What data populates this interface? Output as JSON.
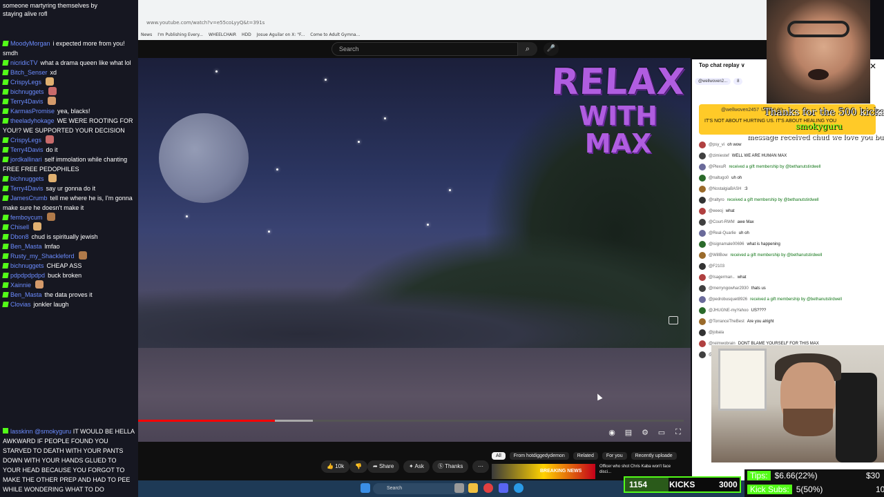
{
  "browser": {
    "url": "www.youtube.com/watch?v=e55coLyyQ&t=391s",
    "bookmarks": [
      "News",
      "I'm Publishing Every...",
      "WHEELCHAIR",
      "HDD",
      "Josue Aguilar on X: \"F...",
      "Come to Adult Gymna..."
    ]
  },
  "youtube": {
    "search_placeholder": "Search",
    "search_icon": "search-icon",
    "mic_icon": "mic-icon",
    "video_logo_line1": "RELAX",
    "video_logo_line2": "WITH MAX",
    "progress_fraction": 0.25,
    "buffer_fraction": 0.32,
    "actions": {
      "like_count": "10k",
      "share": "Share",
      "ask": "Ask",
      "thanks": "Thanks"
    },
    "chips": [
      "All",
      "From hotdiggedydemon",
      "Related",
      "For you",
      "Recently uploade"
    ],
    "rec": {
      "thumb_text": "BREAKING NEWS",
      "title": "Officer who shot Chris Kaba won't face disci..."
    },
    "taskbar_search": "Search"
  },
  "yt_chat": {
    "header": "Top chat replay",
    "pinned": [
      "@wellwoven2...",
      "8"
    ],
    "superchat": {
      "user": "@wellwoven2457",
      "amount": "US$10.00",
      "text": "IT'S NOT ABOUT HURTING US. IT'S ABOUT HEALING YOU"
    },
    "messages": [
      {
        "user": "@psy_vi",
        "text": "oh wow",
        "kind": "normal"
      },
      {
        "user": "@zimiestef",
        "text": "WELL WE ARE HUMAN MAX",
        "kind": "normal"
      },
      {
        "user": "@PlexuR",
        "text": "received a gift membership by @bethanutstirdwell",
        "kind": "member"
      },
      {
        "user": "@naltugo0",
        "text": "uh oh",
        "kind": "normal"
      },
      {
        "user": "@NostalgiaBASH",
        "text": ":3",
        "kind": "normal"
      },
      {
        "user": "@raltyro",
        "text": "received a gift membership by @bethanutstirdwell",
        "kind": "member"
      },
      {
        "user": "@eeeoj",
        "text": "what",
        "kind": "normal"
      },
      {
        "user": "@Court-RWM",
        "text": "awe Max",
        "kind": "normal"
      },
      {
        "user": "@Real-Quarlie",
        "text": "uh oh",
        "kind": "normal"
      },
      {
        "user": "@isignamale00696",
        "text": "what is happening",
        "kind": "normal"
      },
      {
        "user": "@WillBow",
        "text": "received a gift membership by @bethanutstirdwell",
        "kind": "member"
      },
      {
        "user": "@F2103",
        "text": "",
        "kind": "normal"
      },
      {
        "user": "@Isagerman..",
        "text": "what",
        "kind": "normal"
      },
      {
        "user": "@merryngowhar2930",
        "text": "thats us",
        "kind": "normal"
      },
      {
        "user": "@pedrobusquet8926",
        "text": "received a gift membership by @bethanutstirdwell",
        "kind": "member"
      },
      {
        "user": "@JHUGNE-myYahoo",
        "text": "US????",
        "kind": "normal"
      },
      {
        "user": "@TorranceTheBest",
        "text": "Are you alright",
        "kind": "normal"
      },
      {
        "user": "@jobala",
        "text": "",
        "kind": "normal"
      },
      {
        "user": "@reimwobrain",
        "text": "DONT BLAME YOURSELF FOR THIS MAX",
        "kind": "normal"
      },
      {
        "user": "@timhow12",
        "text": "received a gift membership by @bethanutstirdwell",
        "kind": "member"
      }
    ]
  },
  "kick_chat": {
    "top_lines": [
      "someone martyring themselves by",
      "staying alive rofl"
    ],
    "messages": [
      {
        "user": "MoodyMorgan",
        "text": "i expected more from you! smdh"
      },
      {
        "user": "nicridicTV",
        "text": "what a drama queen like what lol"
      },
      {
        "user": "Bitch_Senser",
        "text": "xd"
      },
      {
        "user": "CrispyLegs",
        "text": ""
      },
      {
        "user": "bichnuggets",
        "text": ""
      },
      {
        "user": "Terry4Davis",
        "text": ""
      },
      {
        "user": "KarmasPromise",
        "text": "yea, blacks!"
      },
      {
        "user": "theeladyhokage",
        "text": "WE WERE ROOTING FOR YOU!? WE SUPPORTED YOUR DECISION"
      },
      {
        "user": "CrispyLegs",
        "text": ""
      },
      {
        "user": "Terry4Davis",
        "text": "do it"
      },
      {
        "user": "jordkallinari",
        "text": "self immolation while chanting FREE FREE PEDOPHILES"
      },
      {
        "user": "bichnuggets",
        "text": ""
      },
      {
        "user": "Terry4Davis",
        "text": "say ur gonna do it"
      },
      {
        "user": "JamesCrumb",
        "text": "tell me where he is, I'm gonna make sure he doesn't make it"
      },
      {
        "user": "femboycum",
        "text": ""
      },
      {
        "user": "Chisell",
        "text": ""
      },
      {
        "user": "Dbon8",
        "text": "chud is spiritually jewish"
      },
      {
        "user": "Ben_Masta",
        "text": "lmfao"
      },
      {
        "user": "Rusty_my_Shackleford",
        "text": ""
      },
      {
        "user": "bichnuggets",
        "text": "CHEAP ASS"
      },
      {
        "user": "pdpdpdpdpd",
        "text": "buck broken"
      },
      {
        "user": "Xainnie",
        "text": ""
      },
      {
        "user": "Ben_Masta",
        "text": "the data proves it"
      },
      {
        "user": "Clovias",
        "text": "jonkler laugh"
      }
    ],
    "bottom": {
      "user": "lasskinn",
      "mention": "@smokyguru",
      "text": "IT WOULD BE HELLA AWKWARD IF PEOPLE FOUND YOU STARVED TO DEATH WITH YOUR PANTS DOWN WITH YOUR HANDS GLUED TO YOUR HEAD BECAUSE YOU FORGOT TO MAKE THE OTHER PREP AND HAD TO PEE WHILE WONDERING WHAT TO DO"
    }
  },
  "overlays": {
    "thanks": "Thanks for the 500 kicks",
    "user": "smokyguru",
    "message": "message received chud we love you buddy"
  },
  "stats": {
    "kicks_count": "1154",
    "kicks_label": "KICKS",
    "kicks_goal": "3000",
    "kicks_fraction": 0.38,
    "tips_label": "Tips:",
    "tips_value": "$6.66(22%)",
    "tips_goal": "$30",
    "subs_label": "Kick Subs:",
    "subs_value": "5(50%)",
    "subs_goal": "10"
  },
  "colors": {
    "kick_green": "#53fc18",
    "yt_red": "#ff0000",
    "relax_purple": "#b05de0",
    "superchat_yellow": "#ffca28"
  }
}
